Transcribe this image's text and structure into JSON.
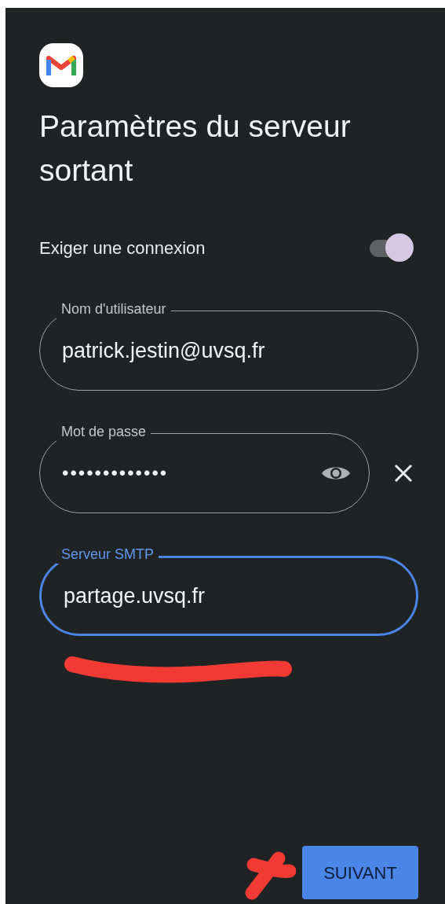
{
  "title": "Paramètres du serveur sortant",
  "require_login": {
    "label": "Exiger une connexion",
    "on": true
  },
  "fields": [
    {
      "kind": "text",
      "label": "Nom d'utilisateur",
      "value": "patrick.jestin@uvsq.fr",
      "focused": false
    },
    {
      "kind": "password",
      "label": "Mot de passe",
      "value": "•••••••••••••",
      "focused": false
    },
    {
      "kind": "text",
      "label": "Serveur SMTP",
      "value": "partage.uvsq.fr",
      "focused": true
    }
  ],
  "next_button": "SUIVANT"
}
